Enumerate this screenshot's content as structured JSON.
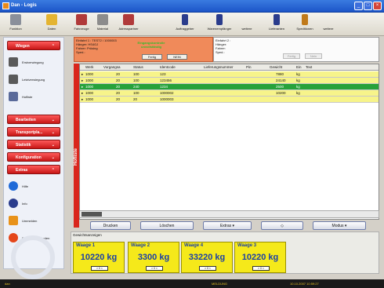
{
  "window": {
    "title": "Dan - Logis"
  },
  "toolbar": [
    {
      "label": "Funktion",
      "icon": "people-icon",
      "color": "#8a8f9a"
    },
    {
      "label": "Daten",
      "icon": "folder-icon",
      "color": "#e4b431"
    },
    {
      "label": "Fahrzeuge",
      "icon": "truck-icon",
      "color": "#b03a3a"
    },
    {
      "label": "Material",
      "icon": "bucket-icon",
      "color": "#8c8c8c"
    },
    {
      "label": "Adresspartner",
      "icon": "partner-icon",
      "color": "#b03a3a"
    },
    {
      "label": "Auftraggeber",
      "icon": "client-icon",
      "color": "#2a3c8c"
    },
    {
      "label": "Warenempfänger",
      "icon": "recipient-icon",
      "color": "#2a3c8c"
    },
    {
      "label": "weitere",
      "icon": "more-icon",
      "color": "#8c8c8c"
    },
    {
      "label": "Lieferanten",
      "icon": "supplier-icon",
      "color": "#2a3c8c"
    },
    {
      "label": "Speditionen",
      "icon": "forwarder-icon",
      "color": "#c07a1a"
    },
    {
      "label": "weitere",
      "icon": "more-icon",
      "color": "#8c8c8c"
    }
  ],
  "sidebar": {
    "wiegen_header": "Wiegen",
    "wiegen_items": [
      {
        "label": "Erstverwiegung",
        "icon": "scale-icon",
        "color": "#5a5a5a"
      },
      {
        "label": "Letztverwiegung",
        "icon": "scale-icon",
        "color": "#5a5a5a"
      },
      {
        "label": "Hofliste",
        "icon": "list-icon",
        "color": "#5a6a9a"
      }
    ],
    "headers": [
      "Bearbeiten",
      "Transportpla...",
      "Statistik",
      "Konfiguration",
      "Extras"
    ],
    "extras_items": [
      {
        "label": "Hilfe",
        "icon": "help-icon",
        "color": "#1f6ad8"
      },
      {
        "label": "Info",
        "icon": "info-icon",
        "color": "#2a3c8c"
      },
      {
        "label": "Ummelden",
        "icon": "switch-user-icon",
        "color": "#e8921a"
      },
      {
        "label": "Programm beenden",
        "icon": "exit-icon",
        "color": "#e4461a"
      }
    ]
  },
  "info_left": {
    "lines": [
      "Einfahrt 1 : TEST2 / 1000003",
      "Hänger: HS4GJ",
      "Fahrer: Prüsing",
      "Sped.:"
    ],
    "warning": "Eingangskontrolle unvollständig",
    "btn_fertig": "Fertig",
    "btn_nein": "NEIN"
  },
  "info_right": {
    "lines": [
      "Einfahrt 2 :",
      "Hänger:",
      "Fahrer:",
      "Sped.:"
    ],
    "btn_fertig": "Fertig",
    "btn_nein": "Nein"
  },
  "side_label": "Hofliste",
  "grid": {
    "headers": [
      "Werk",
      "Vorgangsa",
      "Status",
      "Identcode",
      "Lieferungsnummer",
      "Pin",
      "Gewicht",
      "Ein",
      "Text"
    ],
    "rows": [
      {
        "werk": "1000",
        "vorgang": "20",
        "status": "100",
        "ident": "123",
        "liefer": "",
        "pin": "",
        "gewicht": "7880",
        "ein": "kg",
        "style": "y"
      },
      {
        "werk": "1000",
        "vorgang": "20",
        "status": "100",
        "ident": "123456",
        "liefer": "",
        "pin": "",
        "gewicht": "24140",
        "ein": "kg",
        "style": "y"
      },
      {
        "werk": "1000",
        "vorgang": "20",
        "status": "240",
        "ident": "1234",
        "liefer": "",
        "pin": "",
        "gewicht": "2500",
        "ein": "kg",
        "style": "g"
      },
      {
        "werk": "1000",
        "vorgang": "20",
        "status": "100",
        "ident": "1000002",
        "liefer": "",
        "pin": "",
        "gewicht": "10200",
        "ein": "kg",
        "style": "y"
      },
      {
        "werk": "1000",
        "vorgang": "20",
        "status": "20",
        "ident": "1000003",
        "liefer": "",
        "pin": "",
        "gewicht": "",
        "ein": "",
        "style": "y"
      }
    ]
  },
  "buttons": {
    "drucken": "Drucken",
    "loeschen": "Löschen",
    "extras": "Extras",
    "modus": "Modus"
  },
  "weights": {
    "label": "Gewichtsanzeigen",
    "cards": [
      {
        "name": "Waage 1",
        "value": "10220 kg",
        "zero": "> 0 <"
      },
      {
        "name": "Waage 2",
        "value": "3300 kg",
        "zero": "> 0 <"
      },
      {
        "name": "Waage 4",
        "value": "33220 kg",
        "zero": "> 0 <"
      },
      {
        "name": "Waage 3",
        "value": "10220 kg",
        "zero": "> 0 <"
      }
    ]
  },
  "status": {
    "left": "dan",
    "center": "MELDUNG",
    "right": "10.10.2007 10:59:27"
  }
}
